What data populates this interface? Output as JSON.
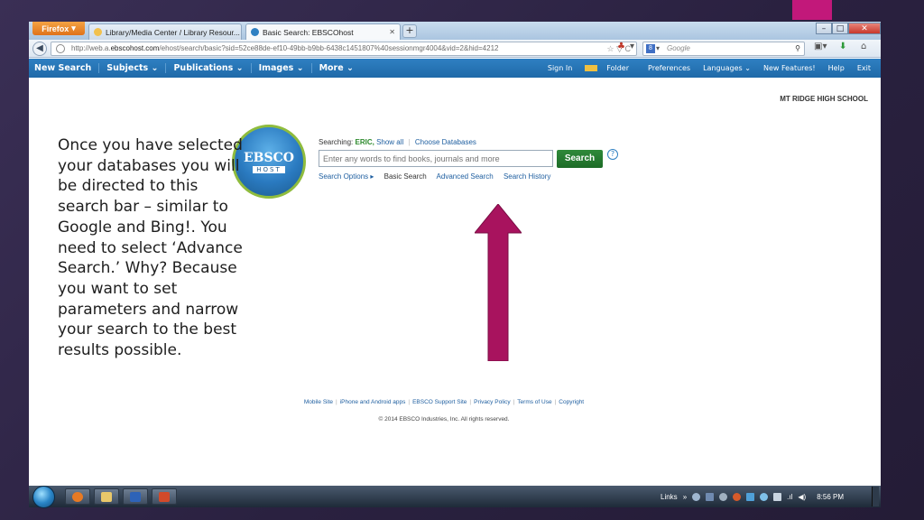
{
  "browser": {
    "app_button": "Firefox",
    "tabs": [
      {
        "title": "Library/Media Center / Library Resour...",
        "active": false
      },
      {
        "title": "Basic Search: EBSCOhost",
        "active": true
      }
    ],
    "new_tab": "+",
    "url_prefix": "http://web.a.",
    "url_domain": "ebscohost.com",
    "url_path": "/ehost/search/basic?sid=52ce88de-ef10-49bb-b9bb-6438c1451807%40sessionmgr4004&vid=2&hid=4212",
    "url_icons": "☆ ▽ C",
    "search_engine_placeholder": "Google",
    "window_controls": [
      "–",
      "□",
      "✕"
    ]
  },
  "ebsco_nav": {
    "left_items": [
      "New Search",
      "Subjects ⌄",
      "Publications ⌄",
      "Images ⌄",
      "More ⌄"
    ],
    "sign_in": "Sign In",
    "folder": "Folder",
    "preferences": "Preferences",
    "languages": "Languages ⌄",
    "new_features": "New Features!",
    "help": "Help",
    "exit": "Exit"
  },
  "institution": "MT RIDGE HIGH SCHOOL",
  "logo": {
    "line1": "EBSCO",
    "line2": "HOST"
  },
  "search": {
    "searching_label": "Searching:",
    "database": "ERIC,",
    "show_all": "Show all",
    "choose_databases": "Choose Databases",
    "placeholder": "Enter any words to find books, journals and more",
    "button": "Search",
    "help_icon": "?",
    "links": {
      "options": "Search Options ▸",
      "basic": "Basic Search",
      "advanced": "Advanced Search",
      "history": "Search History"
    }
  },
  "footer": {
    "links": [
      "Mobile Site",
      "iPhone and Android apps",
      "EBSCO Support Site",
      "Privacy Policy",
      "Terms of Use",
      "Copyright"
    ],
    "copyright": "© 2014 EBSCO Industries, Inc. All rights reserved."
  },
  "slide": {
    "text": "Once you have selected your databases you will be directed to this search bar – similar to Google and Bing!. You need to select ‘Advance Search.’ Why? Because you want to set parameters and narrow your search to the best results possible.",
    "accent_color": "#c2187a"
  },
  "taskbar": {
    "links_label": "Links",
    "links_chevron": "»",
    "clock": "8:56 PM"
  }
}
